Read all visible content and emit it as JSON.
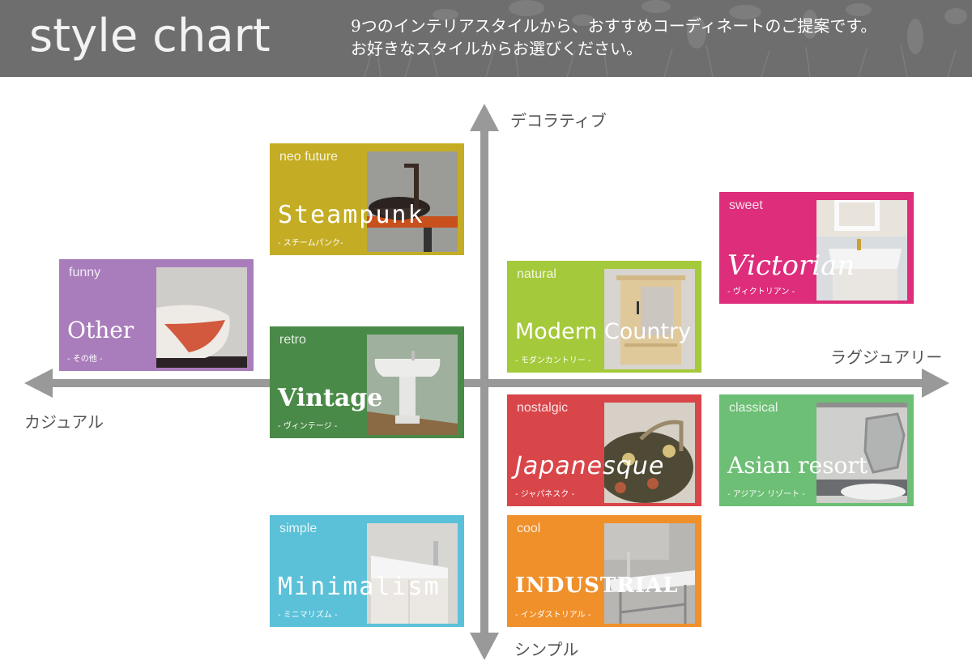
{
  "header": {
    "title": "style chart",
    "description_line1": "9つのインテリアスタイルから、おすすめコーディネートのご提案です。",
    "description_line2": "お好きなスタイルからお選びください。",
    "background_color": "#6e6e6e"
  },
  "axes": {
    "top": "デコラティブ",
    "bottom": "シンプル",
    "left": "カジュアル",
    "right": "ラグジュアリー",
    "arrow_color": "#999999"
  },
  "cards": [
    {
      "id": "steampunk",
      "subtitle": "neo future",
      "title": "Steampunk",
      "kana": "- スチームパンク-",
      "color": "#c4ad24",
      "photo": "sink-bowl-copper-faucet"
    },
    {
      "id": "other",
      "subtitle": "funny",
      "title": "Other",
      "kana": "- その他 -",
      "color": "#a97dbb",
      "photo": "sink-bowl-orange-pattern"
    },
    {
      "id": "vintage",
      "subtitle": "retro",
      "title": "Vintage",
      "kana": "- ヴィンテージ -",
      "color": "#4a8a48",
      "photo": "pedestal-sink"
    },
    {
      "id": "minimalism",
      "subtitle": "simple",
      "title": "Minimalism",
      "kana": "- ミニマリズム -",
      "color": "#5ac1d8",
      "photo": "white-vanity-cabinet"
    },
    {
      "id": "modern-country",
      "subtitle": "natural",
      "title": "Modern Country",
      "kana": "- モダンカントリー -",
      "color": "#a4c93a",
      "photo": "wooden-mirror-cabinet"
    },
    {
      "id": "victorian",
      "subtitle": "sweet",
      "title": "Victorian",
      "kana": "- ヴィクトリアン -",
      "color": "#dd2d7b",
      "photo": "white-vanity-ornate-mirror"
    },
    {
      "id": "japanesque",
      "subtitle": "nostalgic",
      "title": "Japanesque",
      "kana": "- ジャパネスク -",
      "color": "#d9464a",
      "photo": "painted-bowl-sink"
    },
    {
      "id": "asian-resort",
      "subtitle": "classical",
      "title": "Asian resort",
      "kana": "- アジアン リゾート -",
      "color": "#6cbf74",
      "photo": "mirror-tile-sink"
    },
    {
      "id": "industrial",
      "subtitle": "cool",
      "title": "INDUSTRIAL",
      "kana": "- インダストリアル -",
      "color": "#f0902b",
      "photo": "steel-frame-sink"
    }
  ]
}
